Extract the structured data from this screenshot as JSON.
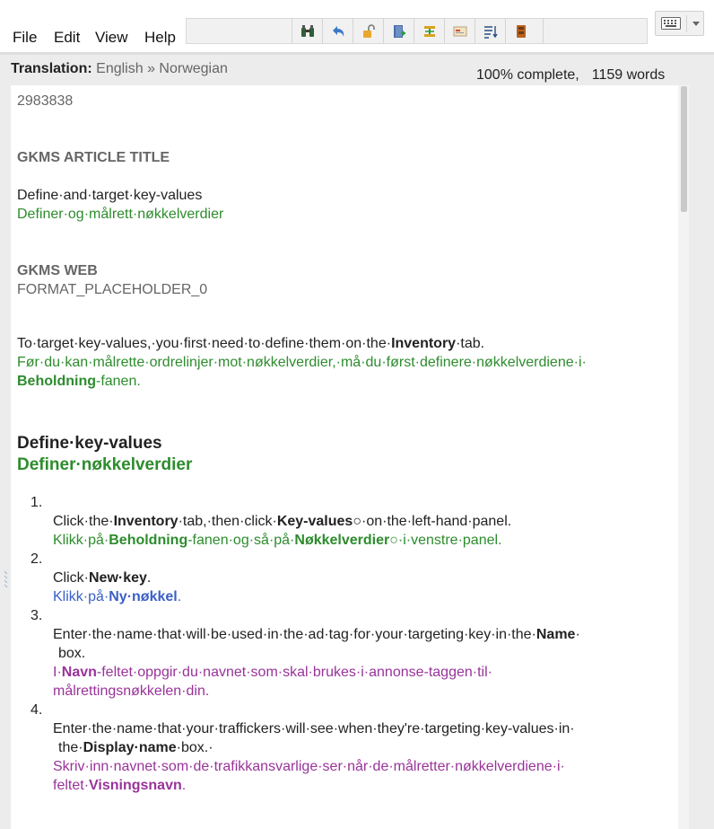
{
  "menu": {
    "file": "File",
    "edit": "Edit",
    "view": "View",
    "help": "Help"
  },
  "toolbar": {
    "buttons": [
      "find-icon",
      "undo-icon",
      "unlock-icon",
      "book-add-icon",
      "merge-icon",
      "card-icon",
      "sort-icon",
      "archive-icon"
    ]
  },
  "header": {
    "label": "Translation:",
    "languages": "English » Norwegian",
    "progress": "100% complete,",
    "words": "1159 words"
  },
  "doc": {
    "id": "2983838",
    "h_article_title": "GKMS ARTICLE TITLE",
    "title_src": "Define·and·target·key-values",
    "title_tgt": "Definer·og·målrett·nøkkelverdier",
    "h_web": "GKMS WEB",
    "placeholder": "FORMAT_PLACEHOLDER_0",
    "p1_src_a": "To·target·key-values,·you·first·need·to·define·them·on·the·",
    "p1_src_b": "Inventory",
    "p1_src_c": "·tab.",
    "p1_tgt_a": "Før·du·kan·målrette·ordrelinjer·mot·nøkkelverdier,·må·du·først·definere·nøkkelverdiene·i·",
    "p1_tgt_b": "Beholdning",
    "p1_tgt_c": "-fanen.",
    "h2_src": "Define·key-values",
    "h2_tgt": "Definer·nøkkelverdier",
    "steps": [
      {
        "num": "1.",
        "src": [
          "Click·the·",
          "Inventory",
          "·tab,·then·click·",
          "Key-values",
          "○·on·the·left-hand·panel."
        ],
        "tgt": [
          "Klikk·på·",
          "Beholdning",
          "-fanen·og·så·på·",
          "Nøkkelverdier",
          "○·i·venstre·panel."
        ]
      },
      {
        "num": "2.",
        "src": [
          "Click·",
          "New·key",
          "."
        ],
        "tgt": [
          "Klikk·på·",
          "Ny·nøkkel",
          "."
        ]
      },
      {
        "num": "3.",
        "src1": [
          "Enter·the·name·that·will·be·used·in·the·ad·tag·for·your·targeting·key·in·the·",
          "Name",
          "·"
        ],
        "src2": "box.",
        "tgt1": [
          "I·",
          "Navn",
          "-feltet·oppgir·du·navnet·som·skal·brukes·i·annonse-taggen·til·"
        ],
        "tgt2": "målrettingsnøkkelen·din."
      },
      {
        "num": "4.",
        "src1": "Enter·the·name·that·your·traffickers·will·see·when·they're·targeting·key-values·in·",
        "src2": [
          "the·",
          "Display·name",
          "·box.·"
        ],
        "tgt1": "Skriv·inn·navnet·som·de·trafikkansvarlige·ser·når·de·målretter·nøkkelverdiene·i·",
        "tgt2": [
          "feltet·",
          "Visningsnavn",
          "."
        ]
      }
    ]
  }
}
